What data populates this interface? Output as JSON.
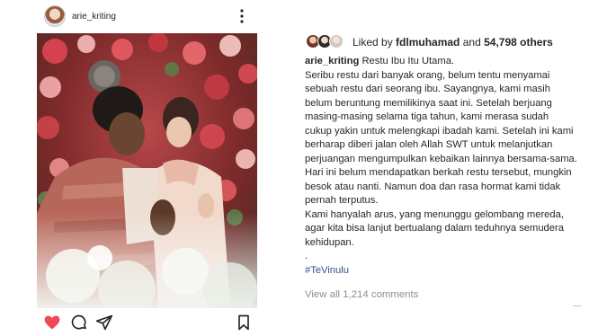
{
  "post": {
    "username": "arie_kriting",
    "image_alt_icon": "photo-couple-praying",
    "actions": {
      "like_icon": "heart-filled-icon",
      "comment_icon": "comment-icon",
      "share_icon": "send-icon",
      "save_icon": "bookmark-icon",
      "liked_color": "#ed4956"
    }
  },
  "likes": {
    "prefix": "Liked by",
    "user": "fdlmuhamad",
    "connector": "and",
    "count": "54,798 others"
  },
  "caption": {
    "username": "arie_kriting",
    "title": "Restu Ibu Itu Utama.",
    "lines": [
      "Seribu restu dari banyak orang, belum tentu menyamai",
      "sebuah restu dari seorang ibu. Sayangnya, kami masih",
      "belum beruntung memilikinya saat ini. Setelah berjuang",
      "masing-masing selama tiga tahun, kami merasa sudah",
      "cukup yakin untuk melengkapi ibadah kami. Setelah ini kami",
      "berharap diberi jalan oleh Allah SWT untuk melanjutkan",
      "perjuangan mengumpulkan kebaikan lainnya bersama-sama.",
      "Hari ini belum mendapatkan berkah restu tersebut, mungkin",
      "besok atau nanti. Namun doa dan rasa hormat kami tidak",
      "pernah terputus.",
      "Kami hanyalah arus, yang menunggu gelombang mereda,",
      "agar kita bisa lanjut bertualang dalam teduhnya semudera",
      "kehidupan.",
      "."
    ],
    "hashtag": "#TeVinulu"
  },
  "comments": {
    "view_all": "View all 1,214 comments"
  }
}
